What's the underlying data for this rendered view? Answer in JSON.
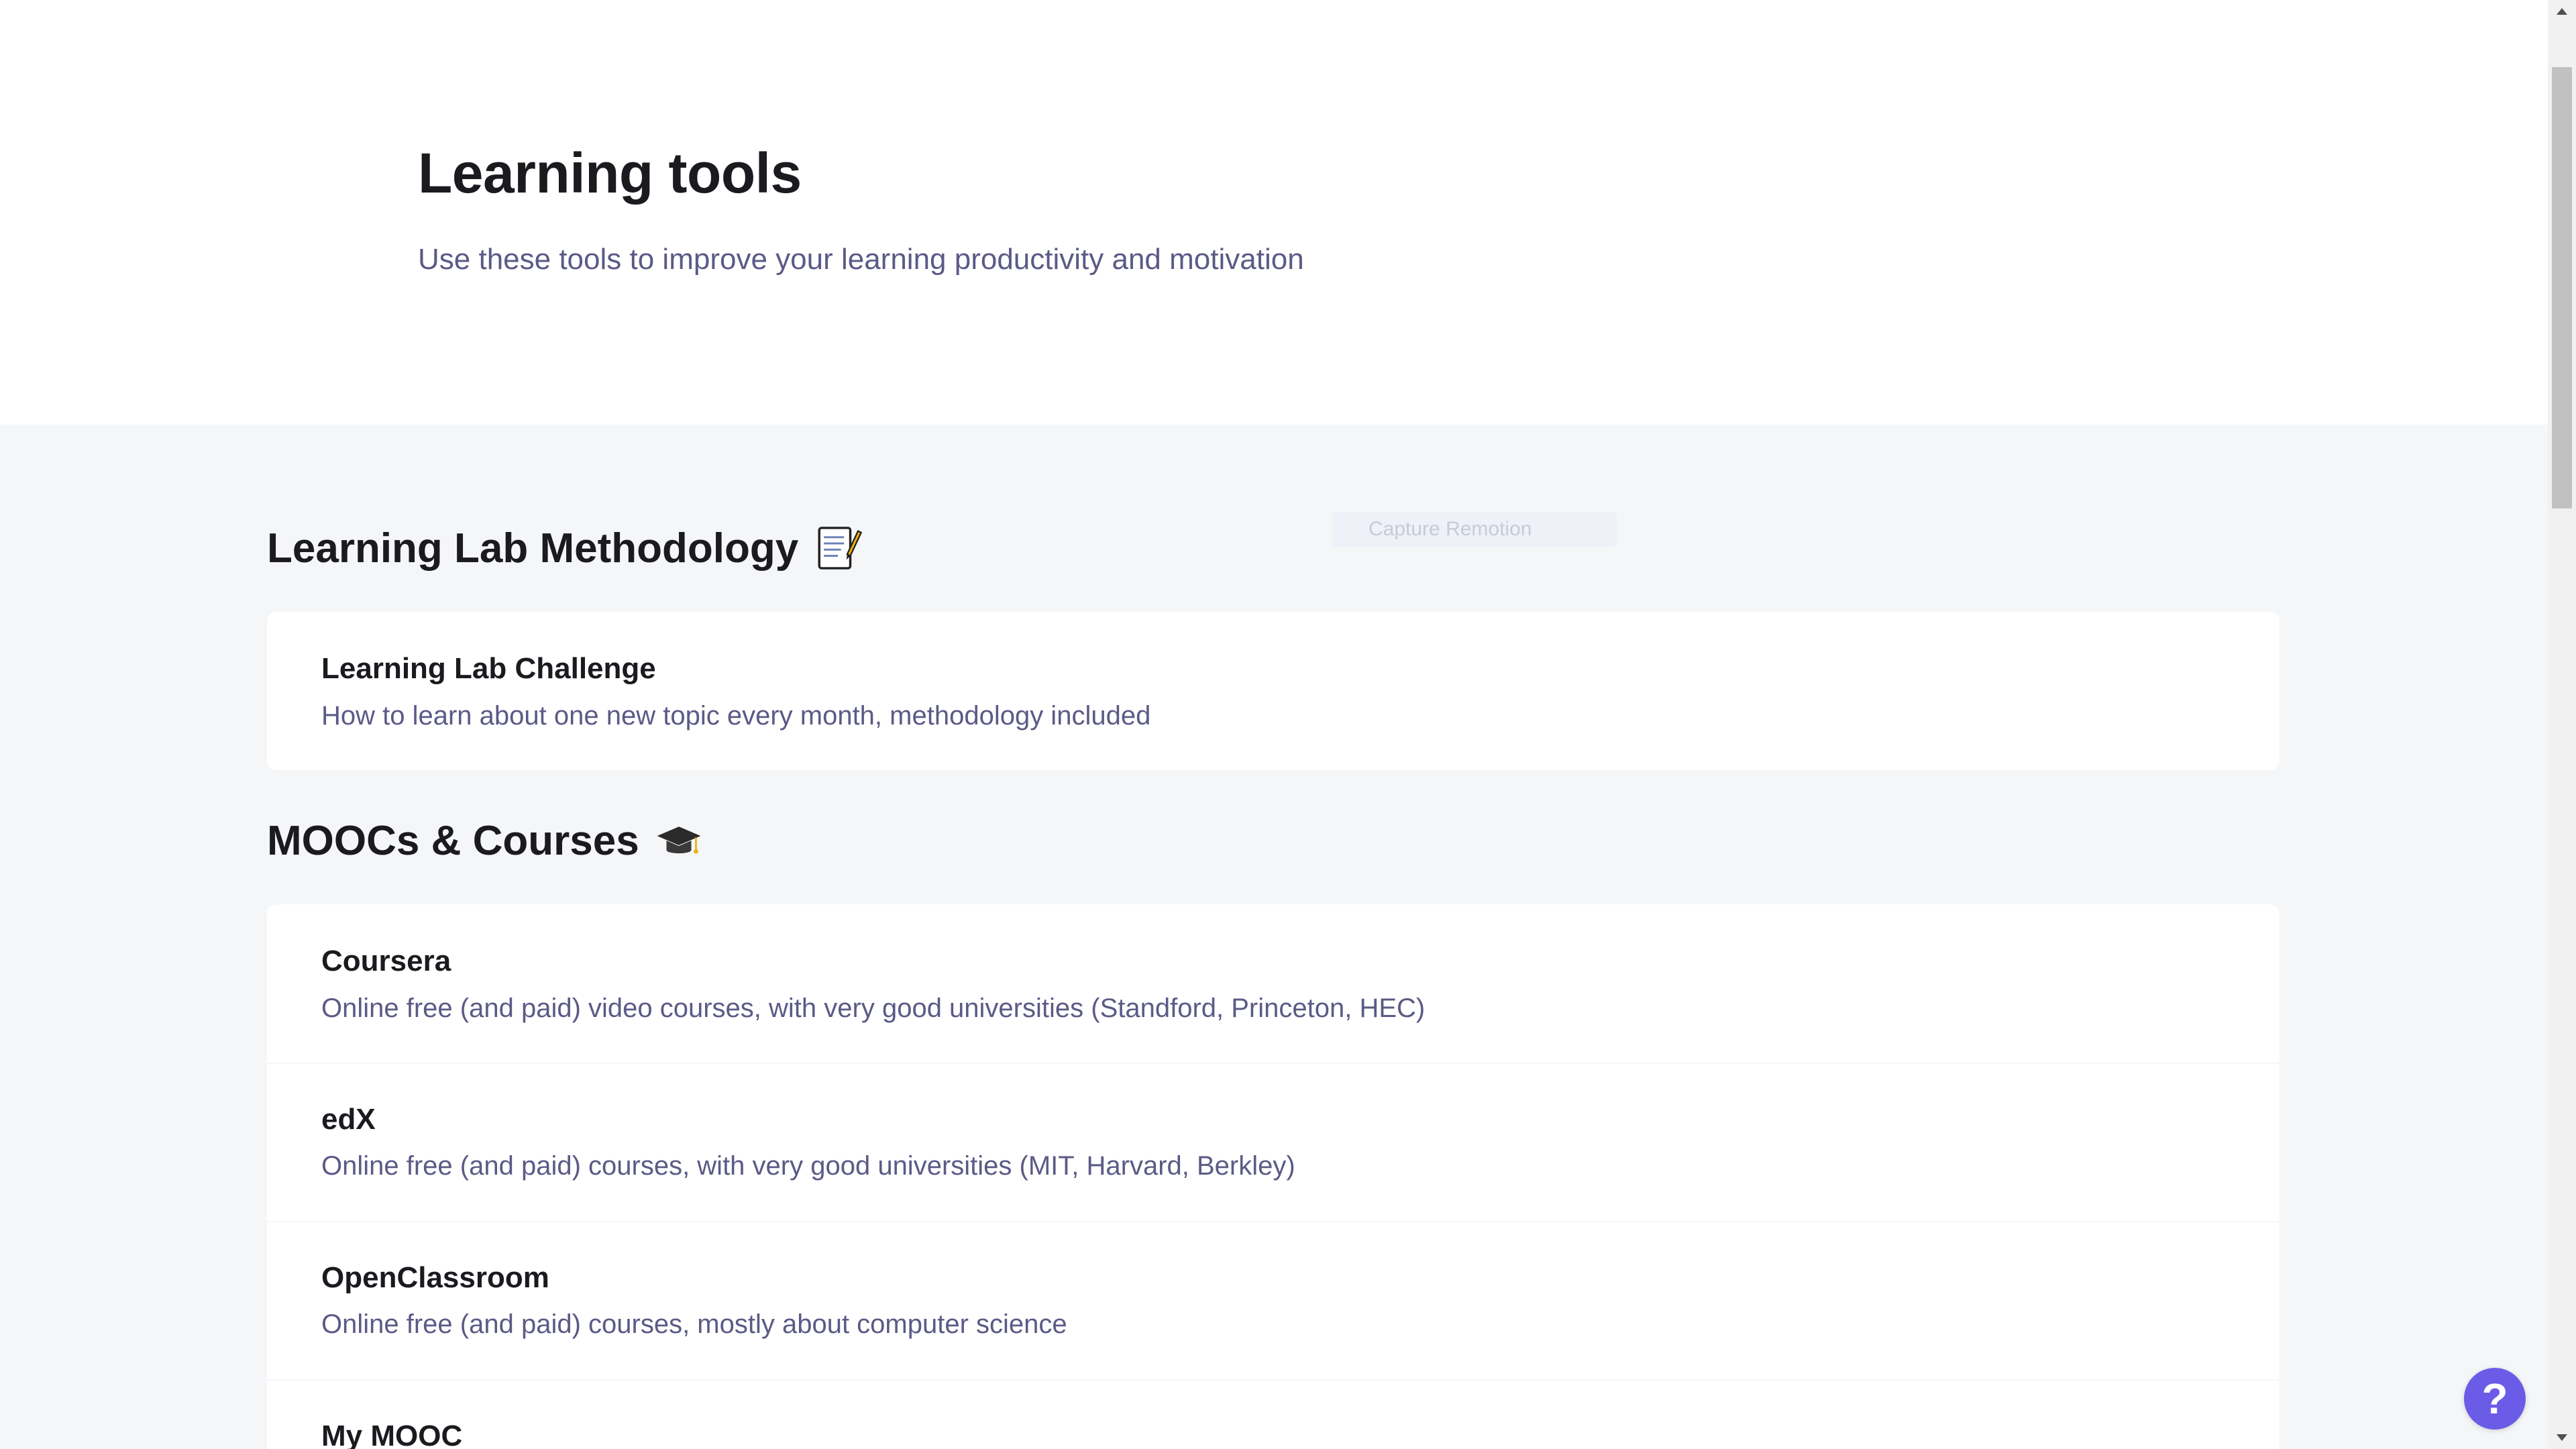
{
  "hero": {
    "title": "Learning tools",
    "subtitle": "Use these tools to improve your learning productivity and motivation"
  },
  "tooltip": {
    "label": "Capture Remotion"
  },
  "sections": [
    {
      "title": "Learning Lab Methodology",
      "icon": "memo-icon",
      "cards": [
        {
          "title": "Learning Lab Challenge",
          "description": "How to learn about one new topic every month, methodology included"
        }
      ]
    },
    {
      "title": "MOOCs & Courses",
      "icon": "graduation-cap-icon",
      "cards": [
        {
          "title": "Coursera",
          "description": "Online free (and paid) video courses, with very good universities (Standford, Princeton, HEC)"
        },
        {
          "title": "edX",
          "description": "Online free (and paid) courses, with very good universities (MIT, Harvard, Berkley)"
        },
        {
          "title": "OpenClassroom",
          "description": "Online free (and paid) courses, mostly about computer science"
        },
        {
          "title": "My MOOC",
          "description": ""
        }
      ]
    }
  ],
  "help": {
    "glyph": "?",
    "icon": "help-icon",
    "color": "#6b5ce7"
  }
}
